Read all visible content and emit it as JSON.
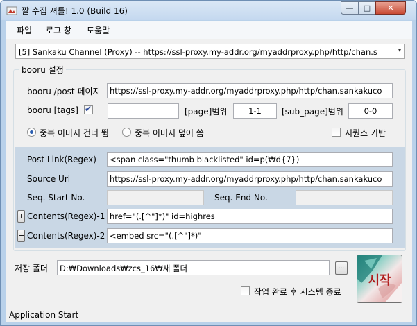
{
  "window": {
    "title": "짤 수집 셔틀! 1.0 (Build 16)",
    "minimize_glyph": "—",
    "maximize_glyph": "□",
    "close_glyph": "✕"
  },
  "menu": {
    "file": "파일",
    "log_window": "로그 창",
    "help": "도움말"
  },
  "site_select": {
    "value": "[5] Sankaku Channel (Proxy) -- https://ssl-proxy.my-addr.org/myaddrproxy.php/http/chan.s",
    "arrow": "▾"
  },
  "booru": {
    "group_title": "booru 설정",
    "post_page_label": "booru /post 페이지",
    "post_page_value": "https://ssl-proxy.my-addr.org/myaddrproxy.php/http/chan.sankakuco",
    "tags_label": "booru [tags]",
    "tags_checked": true,
    "tags_value": "",
    "page_range_label": "[page]범위",
    "page_range_value": "1-1",
    "sub_page_range_label": "[sub_page]범위",
    "sub_page_range_value": "0-0",
    "skip_duplicates_label": "중복 이미지 건너 뜀",
    "overwrite_duplicates_label": "중복 이미지 덮어 씀",
    "selected_duplicate_mode": "skip",
    "sequence_based_label": "시퀀스 기반",
    "sequence_based_checked": false
  },
  "regex": {
    "post_link_label": "Post Link(Regex)",
    "post_link_value": "<span class=\"thumb blacklisted\" id=p(₩d{7})",
    "source_url_label": "Source Url",
    "source_url_value": "https://ssl-proxy.my-addr.org/myaddrproxy.php/http/chan.sankakuco",
    "seq_start_label": "Seq. Start No.",
    "seq_start_value": "",
    "seq_end_label": "Seq. End No.",
    "seq_end_value": "",
    "contents1_button": "+",
    "contents1_label": "Contents(Regex)-1",
    "contents1_value": "href=\"(.[^\"]*)\" id=highres",
    "contents2_button": "−",
    "contents2_label": "Contents(Regex)-2",
    "contents2_value": "<embed src=\"(.[^\"]*)\""
  },
  "save": {
    "folder_label": "저장 폴더",
    "folder_value": "D:₩Downloads₩zcs_16₩새 폴더",
    "browse_label": "...",
    "shutdown_label": "작업 완료 후 시스템 종료",
    "shutdown_checked": false,
    "start_label": "시작"
  },
  "status": {
    "text": "Application Start"
  },
  "icons": {
    "app": "app-icon",
    "check": "check-icon",
    "combo": "chevron-down-icon"
  },
  "colors": {
    "titlebar": "#c4d8ef",
    "panel": "#c9d7e5",
    "start_text": "#b01c1c"
  }
}
